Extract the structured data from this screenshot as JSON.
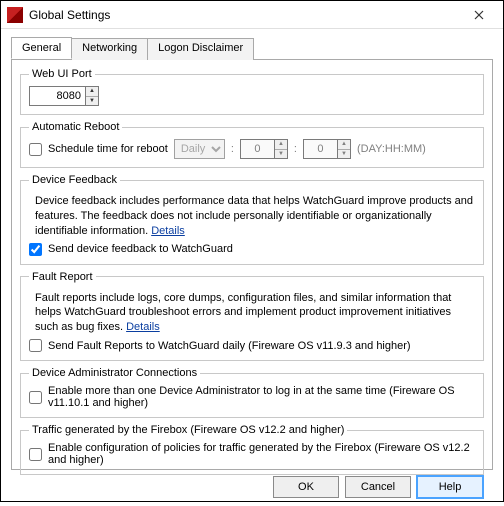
{
  "window": {
    "title": "Global Settings"
  },
  "tabs": {
    "general": "General",
    "networking": "Networking",
    "logon": "Logon Disclaimer"
  },
  "webui": {
    "legend": "Web UI Port",
    "port": "8080"
  },
  "reboot": {
    "legend": "Automatic Reboot",
    "schedule_label": "Schedule time for reboot",
    "freq_selected": "Daily",
    "day_value": "0",
    "hour_value": "0",
    "minute_value": "0",
    "suffix": "(DAY:HH:MM)"
  },
  "feedback": {
    "legend": "Device Feedback",
    "desc_pre": "Device feedback includes performance data that helps WatchGuard improve products and features. The feedback does not include personally identifiable or organizationally identifiable information. ",
    "details": "Details",
    "send_label": "Send device feedback to WatchGuard"
  },
  "fault": {
    "legend": "Fault Report",
    "desc_pre": "Fault reports include logs, core dumps, configuration files, and similar information that helps WatchGuard troubleshoot errors and implement product improvement initiatives such as bug fixes. ",
    "details": "Details",
    "send_label": "Send Fault Reports to WatchGuard daily (Fireware OS v11.9.3 and higher)"
  },
  "admin": {
    "legend": "Device Administrator Connections",
    "enable_label": "Enable more than one Device Administrator to log in at the same time (Fireware OS v11.10.1 and higher)"
  },
  "traffic": {
    "legend": "Traffic generated by the Firebox (Fireware OS v12.2 and higher)",
    "enable_label": "Enable configuration of policies for traffic generated by the Firebox (Fireware OS v12.2 and higher)"
  },
  "buttons": {
    "ok": "OK",
    "cancel": "Cancel",
    "help": "Help"
  }
}
